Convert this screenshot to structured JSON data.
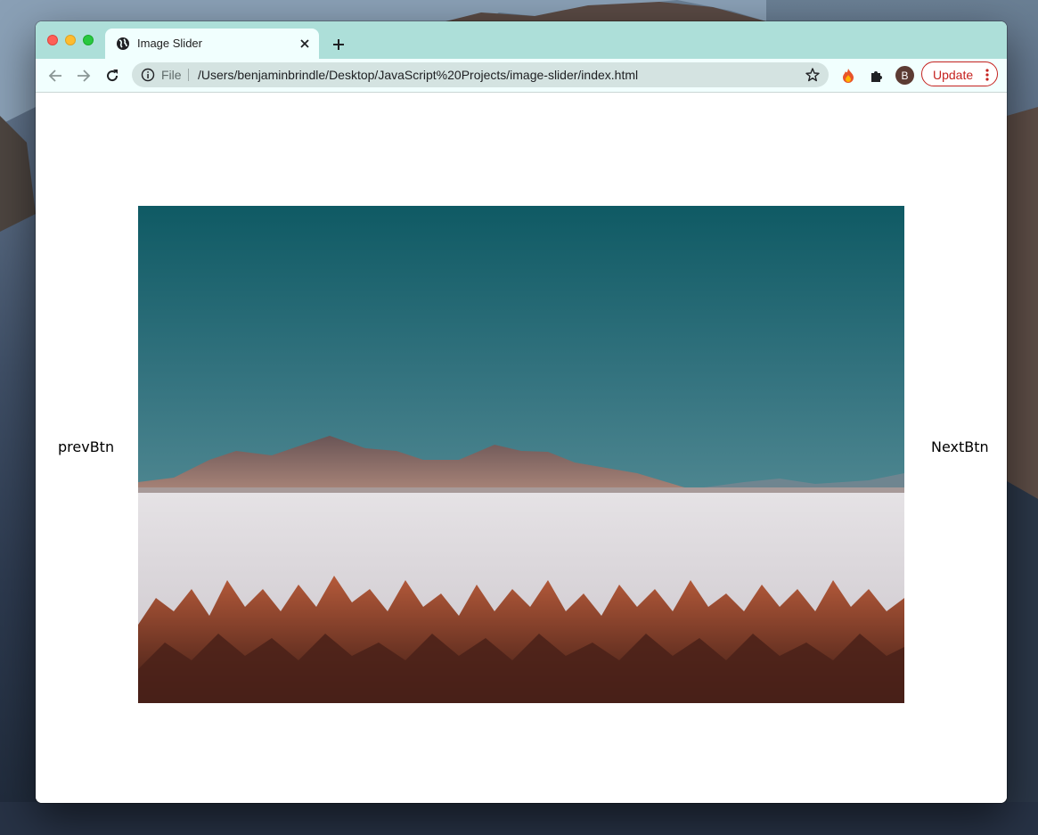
{
  "browser": {
    "tab": {
      "title": "Image Slider",
      "icon": "globe-icon"
    },
    "omnibox": {
      "scheme_label": "File",
      "url": "/Users/benjaminbrindle/Desktop/JavaScript%20Projects/image-slider/index.html"
    },
    "profile_initial": "B",
    "update_label": "Update",
    "colors": {
      "frame": "#addfd9",
      "toolbar": "#f1fffe",
      "update_accent": "#c5221f"
    }
  },
  "page": {
    "prev_label": "prevBtn",
    "next_label": "NextBtn",
    "slide_image": "salt-flats-mountains-photo"
  }
}
